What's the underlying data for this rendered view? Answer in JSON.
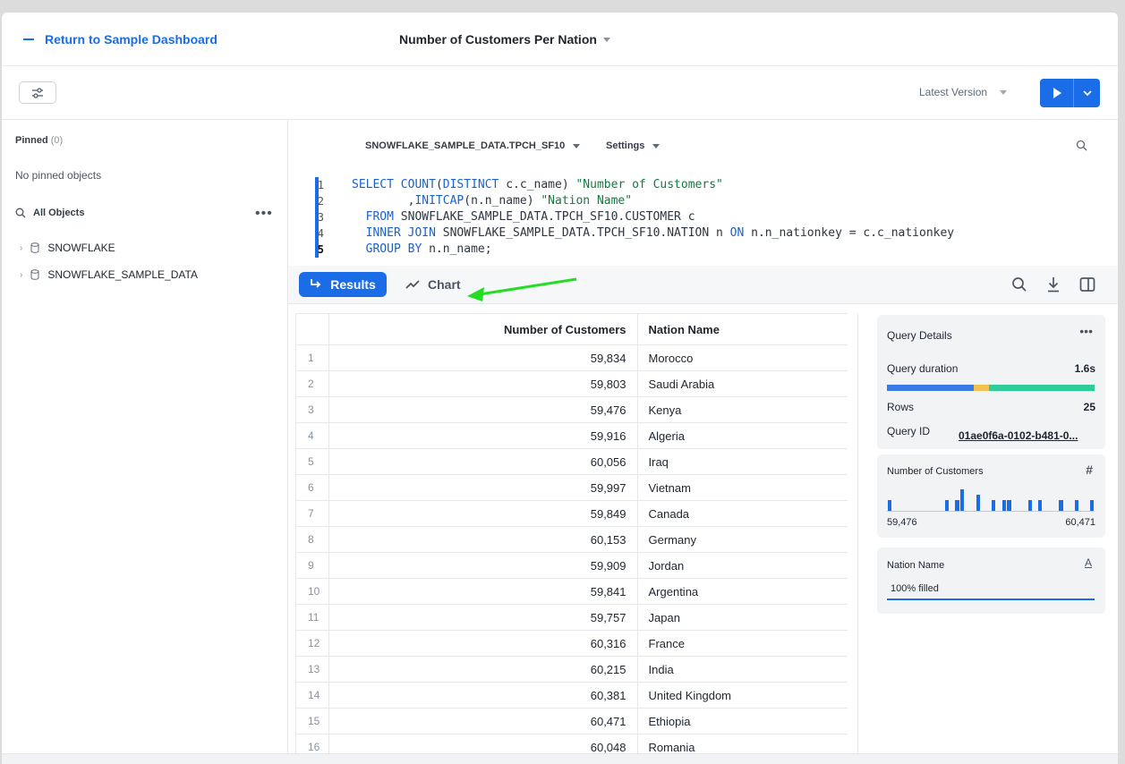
{
  "header": {
    "back_label": "Return to Sample Dashboard",
    "worksheet_title": "Number of Customers Per Nation"
  },
  "toolbar": {
    "version_label": "Latest Version"
  },
  "sidebar": {
    "pinned_label": "Pinned",
    "pinned_count": "(0)",
    "no_pinned": "No pinned objects",
    "all_objects": "All Objects",
    "databases": [
      "SNOWFLAKE",
      "SNOWFLAKE_SAMPLE_DATA"
    ]
  },
  "editor": {
    "context": "SNOWFLAKE_SAMPLE_DATA.TPCH_SF10",
    "settings": "Settings",
    "line_numbers": [
      "1",
      "2",
      "3",
      "4",
      "5"
    ]
  },
  "tabs": {
    "results": "Results",
    "chart": "Chart"
  },
  "grid": {
    "columns": [
      "Number of Customers",
      "Nation Name"
    ],
    "rows": [
      [
        "1",
        "59,834",
        "Morocco"
      ],
      [
        "2",
        "59,803",
        "Saudi Arabia"
      ],
      [
        "3",
        "59,476",
        "Kenya"
      ],
      [
        "4",
        "59,916",
        "Algeria"
      ],
      [
        "5",
        "60,056",
        "Iraq"
      ],
      [
        "6",
        "59,997",
        "Vietnam"
      ],
      [
        "7",
        "59,849",
        "Canada"
      ],
      [
        "8",
        "60,153",
        "Germany"
      ],
      [
        "9",
        "59,909",
        "Jordan"
      ],
      [
        "10",
        "59,841",
        "Argentina"
      ],
      [
        "11",
        "59,757",
        "Japan"
      ],
      [
        "12",
        "60,316",
        "France"
      ],
      [
        "13",
        "60,215",
        "India"
      ],
      [
        "14",
        "60,381",
        "United Kingdom"
      ],
      [
        "15",
        "60,471",
        "Ethiopia"
      ],
      [
        "16",
        "60,048",
        "Romania"
      ]
    ]
  },
  "query_details": {
    "title": "Query Details",
    "duration_label": "Query duration",
    "duration_value": "1.6s",
    "rows_label": "Rows",
    "rows_value": "25",
    "id_label": "Query ID",
    "id_value": "01ae0f6a-0102-b481-0...",
    "bar_colors": [
      "#3b7be8",
      "#f2c14e",
      "#2ecc9a"
    ],
    "bar_fractions": [
      0.42,
      0.07,
      0.51
    ]
  },
  "column_stats": {
    "numeric_title": "Number of Customers",
    "min": "59,476",
    "max": "60,471",
    "text_title": "Nation Name",
    "filled": "100% filled"
  },
  "colors": {
    "accent": "#1a6ce7",
    "annotation_arrow": "#22dd22"
  }
}
